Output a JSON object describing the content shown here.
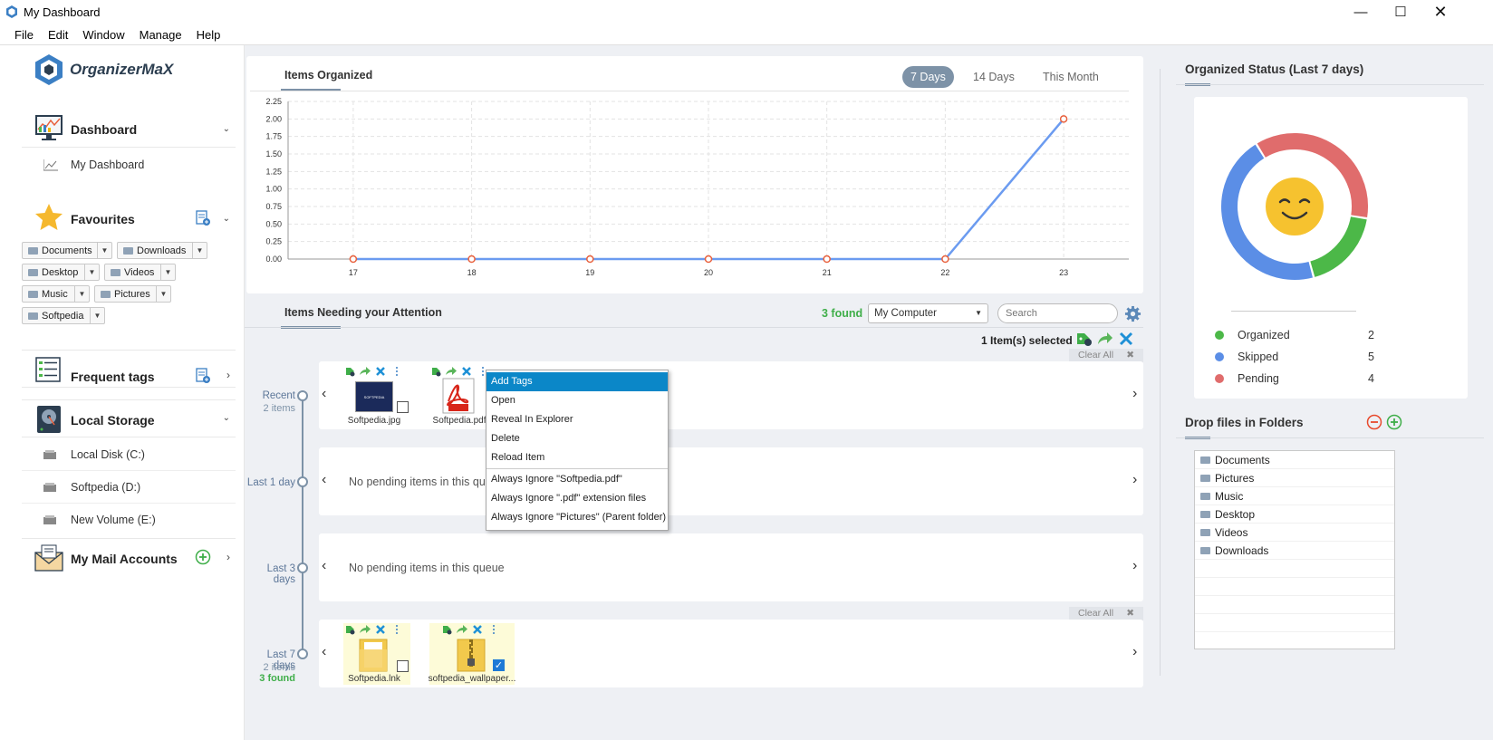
{
  "window": {
    "title": "My Dashboard"
  },
  "menu": [
    "File",
    "Edit",
    "Window",
    "Manage",
    "Help"
  ],
  "brand": {
    "name": "OrganizerMaX"
  },
  "sidebar": {
    "dashboard": {
      "label": "Dashboard",
      "sub": "My Dashboard"
    },
    "favourites": {
      "label": "Favourites",
      "chips": [
        "Documents",
        "Downloads",
        "Desktop",
        "Videos",
        "Music",
        "Pictures",
        "Softpedia"
      ]
    },
    "frequent_tags": {
      "label": "Frequent tags"
    },
    "local_storage": {
      "label": "Local Storage",
      "drives": [
        "Local Disk (C:)",
        "Softpedia (D:)",
        "New Volume (E:)"
      ]
    },
    "mail": {
      "label": "My Mail Accounts"
    }
  },
  "chart_panel": {
    "title": "Items Organized",
    "tabs": [
      "7 Days",
      "14 Days",
      "This Month"
    ],
    "active_tab": "7 Days"
  },
  "chart_data": {
    "type": "line",
    "x": [
      17,
      18,
      19,
      20,
      21,
      22,
      23
    ],
    "y": [
      0,
      0,
      0,
      0,
      0,
      0,
      2
    ],
    "ylim": [
      0,
      2.25
    ],
    "yticks": [
      "0.00",
      "0.25",
      "0.50",
      "0.75",
      "1.00",
      "1.25",
      "1.50",
      "1.75",
      "2.00",
      "2.25"
    ],
    "grid": true,
    "line_color": "#6b9bf0",
    "marker_color": "#e8603c"
  },
  "attention": {
    "title": "Items Needing your Attention",
    "found": "3 found",
    "location": "My Computer",
    "search_placeholder": "Search",
    "selected": "1 Item(s) selected",
    "clear_all": "Clear All",
    "no_pending": "No pending items in this queue",
    "queues": [
      {
        "label": "Recent",
        "count": "2 items",
        "files": [
          "Softpedia.jpg",
          "Softpedia.pdf"
        ]
      },
      {
        "label": "Last 1 day"
      },
      {
        "label": "Last 3 days"
      },
      {
        "label": "Last 7 days",
        "count": "2 items",
        "found": "3 found",
        "files": [
          "Softpedia.lnk",
          "softpedia_wallpaper..."
        ]
      }
    ]
  },
  "context_menu": {
    "items": [
      "Add Tags",
      "Open",
      "Reveal In Explorer",
      "Delete",
      "Reload Item"
    ],
    "ignore_items": [
      "Always Ignore \"Softpedia.pdf\"",
      "Always Ignore \".pdf\" extension files",
      "Always Ignore \"Pictures\" (Parent folder)"
    ]
  },
  "status": {
    "title": "Organized Status (Last 7 days)",
    "legend": [
      {
        "label": "Organized",
        "value": "2",
        "color": "#4cb848"
      },
      {
        "label": "Skipped",
        "value": "5",
        "color": "#5b8ee6"
      },
      {
        "label": "Pending",
        "value": "4",
        "color": "#e06c6c"
      }
    ]
  },
  "drop": {
    "title": "Drop files in Folders",
    "folders": [
      "Documents",
      "Pictures",
      "Music",
      "Desktop",
      "Videos",
      "Downloads"
    ]
  }
}
